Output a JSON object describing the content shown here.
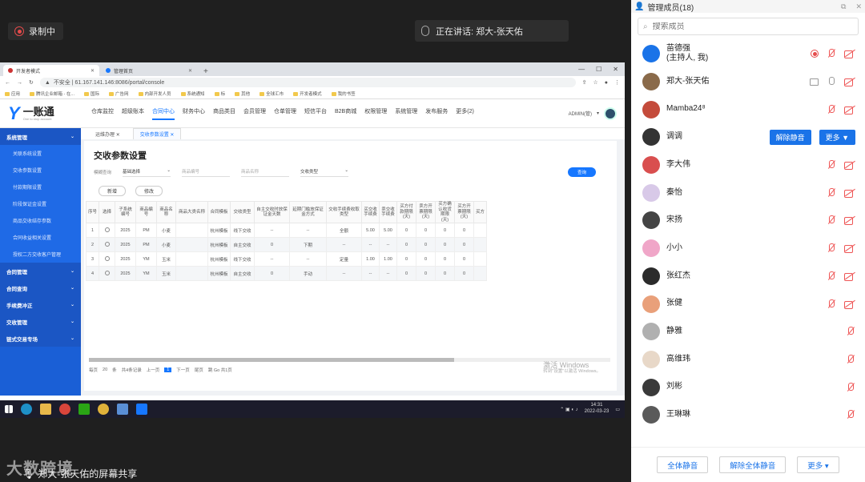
{
  "meeting": {
    "recording_label": "录制中",
    "speaking_label": "正在讲话: 郑大-张天佑",
    "share_caption": "郑大-张天佑的屏幕共享",
    "watermark": "大数跨境"
  },
  "browser": {
    "tabs": [
      {
        "label": "开发者模式"
      },
      {
        "label": "管理首页"
      }
    ],
    "newtab": "+",
    "address": "不安全 | 61.167.141.146:8086/portal/console",
    "bookmarks": [
      "应用",
      "腾讯企业邮箱 - 在...",
      "国际",
      "广告网",
      "内部开发人员",
      "系统通知",
      "标",
      "其他",
      "全球汇市",
      "开发者模式",
      "我的书签"
    ]
  },
  "app": {
    "logo_text": "一账通",
    "logo_sub": "One to stop account",
    "nav": [
      "仓库监控",
      "超级账本",
      "合同中心",
      "财务中心",
      "商品类目",
      "会员管理",
      "仓单管理",
      "短信平台",
      "B2B商城",
      "权限管理",
      "系统管理",
      "发布服务",
      "更多(2)"
    ],
    "active_nav": "合同中心",
    "user": "ADMIN(管)",
    "sidebar": [
      {
        "label": "系统管理",
        "type": "group"
      },
      {
        "label": "关联系统设置",
        "type": "item"
      },
      {
        "label": "交收参数设置",
        "type": "item"
      },
      {
        "label": "付款期限设置",
        "type": "item"
      },
      {
        "label": "阶段保证金设置",
        "type": "item"
      },
      {
        "label": "商品交收结存参数",
        "type": "item"
      },
      {
        "label": "合同收益相关设置",
        "type": "item"
      },
      {
        "label": "授权二方交收客户管理",
        "type": "item"
      },
      {
        "label": "合同管理",
        "type": "group"
      },
      {
        "label": "合同查询",
        "type": "group"
      },
      {
        "label": "手续费冲正",
        "type": "group"
      },
      {
        "label": "交收管理",
        "type": "group"
      },
      {
        "label": "链式交易专场",
        "type": "group"
      }
    ],
    "page_tabs": [
      "运维办理",
      "交收参数设置"
    ],
    "page_title": "交收参数设置",
    "filters": {
      "label": "模糊查询",
      "select1": "基础选择",
      "ph1": "商品编号",
      "ph2": "商品名称",
      "select2": "交收类型",
      "query": "查询"
    },
    "actions": {
      "add": "新增",
      "edit": "修改"
    },
    "table": {
      "headers": [
        "序号",
        "选择",
        "子系统编号",
        "商品编号",
        "商品名称",
        "商品大类名称",
        "合同模板",
        "交收类型",
        "自主交收时放保证金天数",
        "延期门槛放保证金方式",
        "交收手续费收取类型",
        "买交收手续费",
        "卖交收手续费",
        "买方付款期限(天)",
        "卖方开票期限(天)",
        "买方确认收货期限(天)",
        "买方开票期限(天)",
        "买方"
      ],
      "rows": [
        [
          "1",
          "",
          "2025",
          "PM",
          "小麦",
          "",
          "杭州模板",
          "线下交收",
          "--",
          "--",
          "全额",
          "5.00",
          "5.00",
          "0",
          "0",
          "0",
          "0",
          ""
        ],
        [
          "2",
          "",
          "2025",
          "PM",
          "小麦",
          "",
          "杭州模板",
          "自主交收",
          "0",
          "下期",
          "--",
          "--",
          "--",
          "0",
          "0",
          "0",
          "0",
          ""
        ],
        [
          "3",
          "",
          "2025",
          "YM",
          "玉米",
          "",
          "杭州模板",
          "线下交收",
          "--",
          "--",
          "定量",
          "1.00",
          "1.00",
          "0",
          "0",
          "0",
          "0",
          ""
        ],
        [
          "4",
          "",
          "2025",
          "YM",
          "玉米",
          "",
          "杭州模板",
          "自主交收",
          "0",
          "手动",
          "--",
          "--",
          "--",
          "0",
          "0",
          "0",
          "0",
          ""
        ]
      ]
    },
    "pager": {
      "total": "共4条记录",
      "size": "20",
      "per": "条",
      "first": "上一页",
      "page": "1",
      "next": "下一页",
      "last": "尾页",
      "goto": "跳 Go 共1页",
      "prefix": "每页"
    },
    "activate": {
      "title": "激活 Windows",
      "sub": "转到\"设置\"以激活 Windows。"
    },
    "clock": {
      "time": "14:31",
      "date": "2022-03-23"
    }
  },
  "members_panel": {
    "title": "管理成员(18)",
    "search_placeholder": "搜索成员",
    "members": [
      {
        "name": "苗德强",
        "sub": "(主持人, 我)",
        "color": "#1a73e8",
        "icons": "rec-mic-cam"
      },
      {
        "name": "郑大-张天佑",
        "color": "#8a6a4a",
        "icons": "share-mic-cam"
      },
      {
        "name": "Mamba24⁸",
        "color": "#c44b3b",
        "icons": "mic-cam"
      },
      {
        "name": "调调",
        "color": "#333333",
        "icons": "buttons",
        "btn1": "解除静音",
        "btn2": "更多 ▼"
      },
      {
        "name": "李大伟",
        "color": "#d94f4f",
        "icons": "mic-cam"
      },
      {
        "name": "秦怡",
        "color": "#d8c9e8",
        "icons": "mic-cam"
      },
      {
        "name": "宋扬",
        "color": "#444444",
        "icons": "mic-cam"
      },
      {
        "name": "小小",
        "color": "#f0a6c8",
        "icons": "mic-cam"
      },
      {
        "name": "张红杰",
        "color": "#2b2b2b",
        "icons": "mic-cam"
      },
      {
        "name": "张健",
        "color": "#e9a07a",
        "icons": "mic-cam"
      },
      {
        "name": "静雅",
        "color": "#b0b0b0",
        "icons": "mic"
      },
      {
        "name": "高维玮",
        "color": "#e8d8c8",
        "icons": "mic"
      },
      {
        "name": "刘彬",
        "color": "#3a3a3a",
        "icons": "mic"
      },
      {
        "name": "王琳琳",
        "color": "#5a5a5a",
        "icons": "mic"
      }
    ],
    "footer": {
      "mute_all": "全体静音",
      "unmute_all": "解除全体静音",
      "more": "更多 ▾"
    }
  }
}
